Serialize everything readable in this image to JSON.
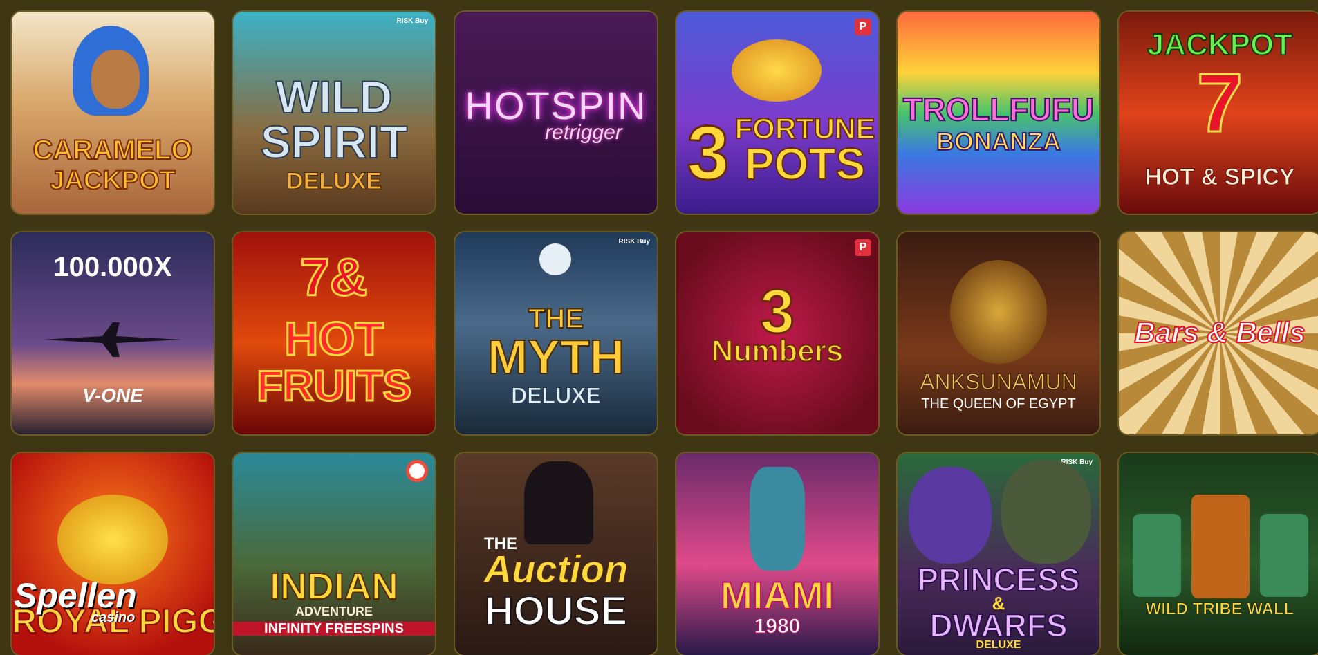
{
  "games": [
    {
      "id": "caramelo",
      "line1": "CARAMELO",
      "line2": "JACKPOT"
    },
    {
      "id": "wild-spirit",
      "line1": "WILD",
      "line2": "SPIRIT",
      "line3": "DELUXE",
      "badge": "RISK Buy"
    },
    {
      "id": "hot-spin",
      "line1": "HOTSPIN",
      "line2": "retrigger"
    },
    {
      "id": "fortune-pots",
      "line1": "3",
      "line2": "FORTUNE",
      "line3": "POTS",
      "badge": "P"
    },
    {
      "id": "trollfufu",
      "line1": "TROLLFUFU",
      "line2": "BONANZA"
    },
    {
      "id": "jackpot-hot-spicy",
      "line1": "JACKPOT",
      "line2": "7",
      "line3": "HOT & SPICY"
    },
    {
      "id": "v-one",
      "line1": "100.000X",
      "line2": "V-ONE"
    },
    {
      "id": "7-hot-fruits",
      "line1": "7&",
      "line2": "HOT",
      "line3": "FRUITS"
    },
    {
      "id": "the-myth",
      "line1": "THE",
      "line2": "MYTH",
      "line3": "DELUXE",
      "badge": "RISK Buy"
    },
    {
      "id": "3-numbers",
      "line1": "3",
      "line2": "Numbers",
      "badge": "P"
    },
    {
      "id": "anksunamun",
      "line1": "ANKSUNAMUN",
      "line2": "THE QUEEN OF EGYPT"
    },
    {
      "id": "bars-bells",
      "line1": "Bars & Bells"
    },
    {
      "id": "royal-piggy",
      "line1": "ROYAL PIGGY"
    },
    {
      "id": "indian-adventure",
      "line1": "INDIAN",
      "line2": "ADVENTURE",
      "line3": "INFINITY FREESPINS"
    },
    {
      "id": "auction-house",
      "line1": "THE",
      "line2": "Auction",
      "line3": "HOUSE"
    },
    {
      "id": "miami",
      "line1": "MIAMI",
      "line2": "1980"
    },
    {
      "id": "princess-dwarfs",
      "line1": "PRINCESS",
      "line2": "&",
      "line3": "DWARFS",
      "line4": "DELUXE",
      "badge": "RISK Buy"
    },
    {
      "id": "wild-tribe-wall",
      "line1": "WILD TRIBE WALL"
    }
  ],
  "brand": {
    "name": "Spellen",
    "sub": "casino"
  },
  "colors": {
    "page_bg": "#3f3614",
    "tile_border": "#6b5a22",
    "badge_red": "#e0323c"
  }
}
